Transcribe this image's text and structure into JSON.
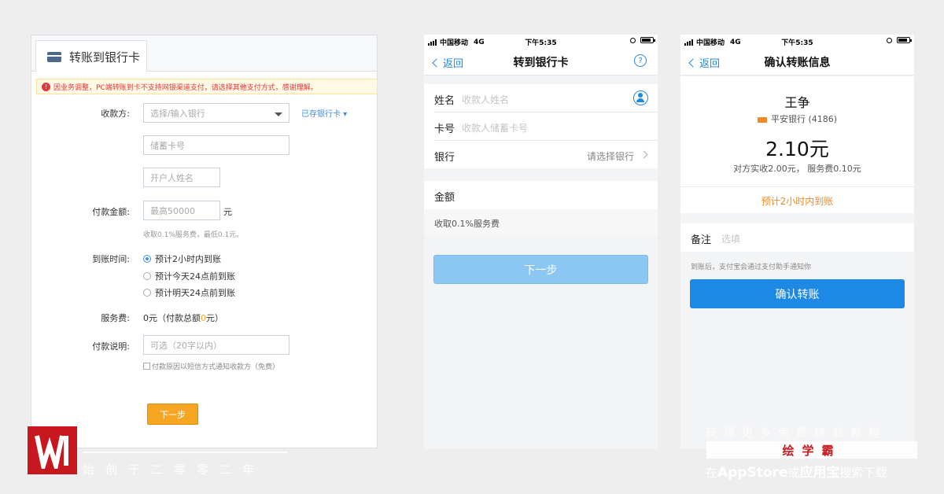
{
  "pc": {
    "tab_label": "转账到银行卡",
    "notice": "因业务调整，PC端转账到卡不支持网银渠道支付，请选择其他支付方式，感谢理解。",
    "payee_label": "收款方:",
    "bank_select_placeholder": "选择/输入银行",
    "saved_cards_link": "已存银行卡 ▾",
    "card_number_placeholder": "储蓄卡号",
    "account_name_placeholder": "开户人姓名",
    "amount_label": "付款金额:",
    "amount_placeholder": "最高50000",
    "amount_unit": "元",
    "fee_hint": "收取0.1%服务费，最低0.1元。",
    "arrival_label": "到账时间:",
    "arrival_options": [
      "预计2小时内到账",
      "预计今天24点前到账",
      "预计明天24点前到账"
    ],
    "service_fee_label": "服务费:",
    "service_fee_prefix": "0元（付款总额",
    "service_fee_value": "0",
    "service_fee_suffix": "元）",
    "remark_label": "付款说明:",
    "remark_placeholder": "可选（20字以内）",
    "sms_checkbox_label": "付款原因以短信方式通知收款方（免费）",
    "next_button": "下一步"
  },
  "phone1": {
    "status": {
      "carrier": "中国移动",
      "network": "4G",
      "time": "下午5:35"
    },
    "nav": {
      "back": "返回",
      "title": "转到银行卡",
      "help": "?"
    },
    "name_label": "姓名",
    "name_placeholder": "收款人姓名",
    "card_label": "卡号",
    "card_placeholder": "收款人储蓄卡号",
    "bank_label": "银行",
    "bank_placeholder": "请选择银行",
    "amount_label": "金额",
    "fee_note": "收取0.1%服务费",
    "next_button": "下一步"
  },
  "phone2": {
    "status": {
      "carrier": "中国移动",
      "network": "4G",
      "time": "下午5:35"
    },
    "nav": {
      "back": "返回",
      "title": "确认转账信息"
    },
    "recipient_name": "王争",
    "bank_line": "平安银行 (4186)",
    "amount": "2.10元",
    "amount_detail": "对方实收2.00元，  服务费0.10元",
    "arrival_note": "预计2小时内到账",
    "remark_label": "备注",
    "remark_placeholder": "选填",
    "notify_note": "到账后，支付宝会通过支付助手通知你",
    "confirm_button": "确认转账"
  },
  "watermark": {
    "since": "始创于二零零二年",
    "tagline": "获得更多免费精品教程",
    "brand": "绘学霸",
    "download_prefix": "在",
    "appstore": "AppStore",
    "or": "或",
    "app_treasure": "应用宝",
    "download_suffix": "搜索下载"
  },
  "colors": {
    "brand_blue": "#1e88e5",
    "orange": "#f6a623",
    "disabled_blue": "#8cc6f2",
    "logo_red": "#c8171e"
  }
}
